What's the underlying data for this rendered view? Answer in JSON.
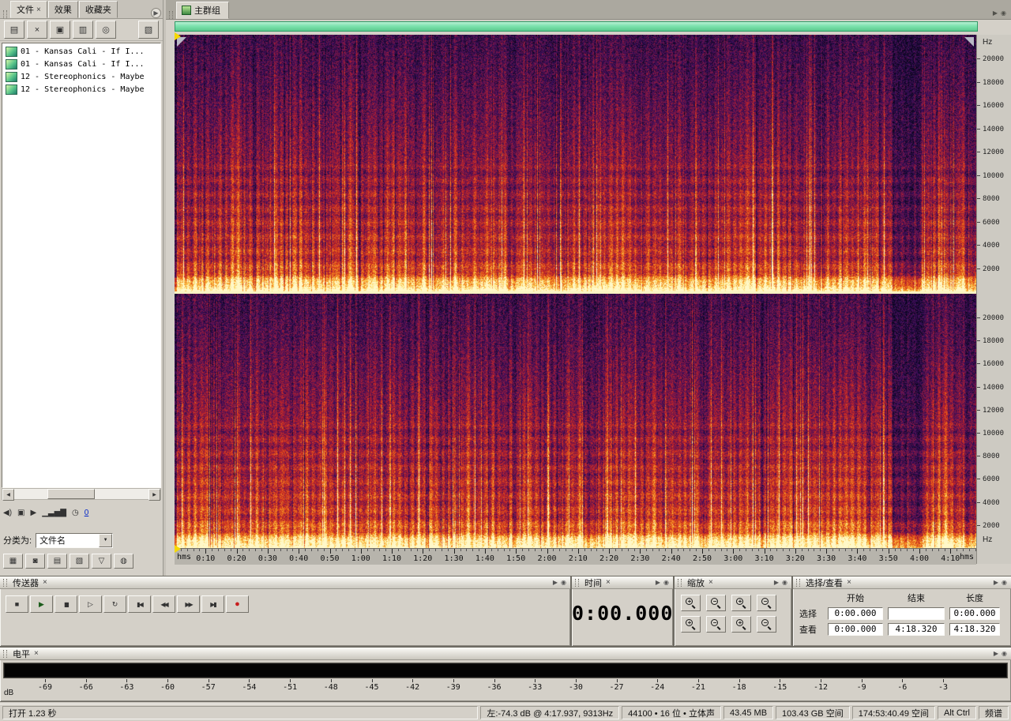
{
  "colors": {
    "chrome": "#d4d0c8",
    "accent_green": "#7de2ae",
    "separator_yellow": "#f8f3c2",
    "record_red": "#c81e1e",
    "meter_bg": "#040404",
    "spectro_palette": [
      "#0a061e",
      "#3a0e5c",
      "#8c1842",
      "#c62624",
      "#e65c1a",
      "#f69e28",
      "#fcd65c",
      "#fff8c8"
    ]
  },
  "icons": {
    "close": "×",
    "dropdown_arrow": "▼",
    "scroll_left": "◀",
    "scroll_right": "▶",
    "panel_menu": "▶",
    "panel_target": "◉",
    "speaker": "◀)",
    "autoplay": "▣",
    "play_small": "▶",
    "volume": "▁▃▅▇",
    "clock": "◷"
  },
  "files_panel": {
    "tabs": [
      {
        "label": "文件",
        "active": true
      },
      {
        "label": "效果",
        "active": false
      },
      {
        "label": "收藏夹",
        "active": false
      }
    ],
    "toolbar_buttons": [
      {
        "name": "import-file",
        "glyph": "▤"
      },
      {
        "name": "close-file",
        "glyph": "×"
      },
      {
        "name": "edit-original",
        "glyph": "▣"
      },
      {
        "name": "insert-into-multitrack",
        "glyph": "▥"
      },
      {
        "name": "insert-into-cd",
        "glyph": "◎"
      },
      {
        "name": "panel-options",
        "glyph": "▧"
      }
    ],
    "files": [
      {
        "name": "01 - Kansas Cali - If I..."
      },
      {
        "name": "01 - Kansas Cali - If I..."
      },
      {
        "name": "12 - Stereophonics - Maybe"
      },
      {
        "name": "12 - Stereophonics - Maybe"
      }
    ],
    "loop_count_label": "0",
    "sort_label": "分类为:",
    "sort_value": "文件名",
    "toggle_buttons": [
      {
        "name": "files-toggle-1",
        "glyph": "▦"
      },
      {
        "name": "files-toggle-2",
        "glyph": "◙"
      },
      {
        "name": "files-toggle-3",
        "glyph": "▤"
      },
      {
        "name": "files-toggle-4",
        "glyph": "▧"
      },
      {
        "name": "files-toggle-filter",
        "glyph": "▽"
      },
      {
        "name": "files-toggle-6",
        "glyph": "◍"
      }
    ]
  },
  "main_view": {
    "tab_label": "主群组",
    "freq_unit": "Hz",
    "freq_max": 22050,
    "freq_ticks": [
      20000,
      18000,
      16000,
      14000,
      12000,
      10000,
      8000,
      6000,
      4000,
      2000
    ],
    "time_unit": "hms",
    "duration_sec": 258.32,
    "time_ticks": [
      "0:10",
      "0:20",
      "0:30",
      "0:40",
      "0:50",
      "1:00",
      "1:10",
      "1:20",
      "1:30",
      "1:40",
      "1:50",
      "2:00",
      "2:10",
      "2:20",
      "2:30",
      "2:40",
      "2:50",
      "3:00",
      "3:10",
      "3:20",
      "3:30",
      "3:40",
      "3:50",
      "4:00",
      "4:10"
    ]
  },
  "transport": {
    "title": "传送器",
    "buttons": [
      {
        "name": "stop",
        "glyph": "■"
      },
      {
        "name": "play",
        "glyph": "▶"
      },
      {
        "name": "pause",
        "glyph": "▮▮"
      },
      {
        "name": "play-from-cursor",
        "glyph": "▷"
      },
      {
        "name": "play-looped",
        "glyph": "↻"
      },
      {
        "name": "go-to-beginning",
        "glyph": "▮◀"
      },
      {
        "name": "rewind",
        "glyph": "◀◀"
      },
      {
        "name": "fast-forward",
        "glyph": "▶▶"
      },
      {
        "name": "go-to-end",
        "glyph": "▶▮"
      },
      {
        "name": "record",
        "glyph": "●"
      }
    ]
  },
  "time_panel": {
    "title": "时间",
    "value": "0:00.000"
  },
  "zoom_panel": {
    "title": "缩放",
    "rows": [
      [
        {
          "name": "zoom-in-horizontal",
          "sign": "+"
        },
        {
          "name": "zoom-out-horizontal",
          "sign": "−"
        },
        {
          "name": "zoom-in-vertical",
          "sign": "+"
        },
        {
          "name": "zoom-out-vertical",
          "sign": "−"
        }
      ],
      [
        {
          "name": "zoom-to-selection",
          "sign": "+"
        },
        {
          "name": "zoom-out-full",
          "sign": "−"
        },
        {
          "name": "zoom-selection-left-edge",
          "sign": "+"
        },
        {
          "name": "zoom-selection-right-edge",
          "sign": "−"
        }
      ]
    ]
  },
  "selection_panel": {
    "title": "选择/查看",
    "columns": {
      "start": "开始",
      "end": "结束",
      "length": "长度"
    },
    "rows": [
      {
        "label": "选择",
        "start": "0:00.000",
        "end": "",
        "length": "0:00.000"
      },
      {
        "label": "查看",
        "start": "0:00.000",
        "end": "4:18.320",
        "length": "4:18.320"
      }
    ]
  },
  "levels_panel": {
    "title": "电平",
    "unit": "dB",
    "ticks": [
      -69,
      -66,
      -63,
      -60,
      -57,
      -54,
      -51,
      -48,
      -45,
      -42,
      -39,
      -36,
      -33,
      -30,
      -27,
      -24,
      -21,
      -18,
      -15,
      -12,
      -9,
      -6,
      -3
    ]
  },
  "status_bar": {
    "message": "打开 1.23 秒",
    "cursor_info": "左:-74.3 dB @  4:17.937, 9313Hz",
    "format_info": "44100 • 16 位 • 立体声",
    "file_size": "43.45 MB",
    "free_space": "103.43 GB 空间",
    "free_time": "174:53:40.49 空间",
    "modifiers": "Alt Ctrl",
    "view_mode": "频谱"
  }
}
